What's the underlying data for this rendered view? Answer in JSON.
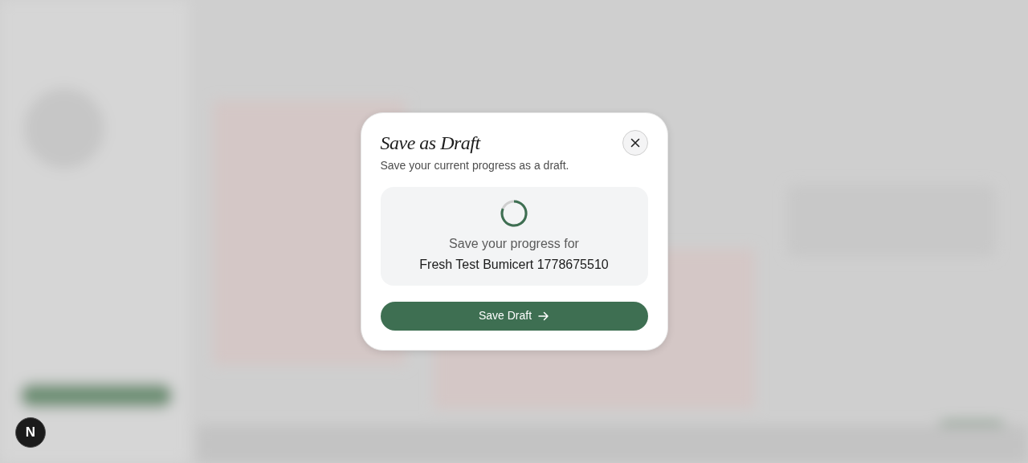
{
  "dialog": {
    "title": "Save as Draft",
    "subtitle": "Save your current progress as a draft.",
    "message": "Save your progress for",
    "project_name": "Fresh Test Bumicert 1778675510",
    "primary_button": {
      "label": "Save Draft"
    }
  },
  "dev_badge": {
    "label": "N"
  }
}
